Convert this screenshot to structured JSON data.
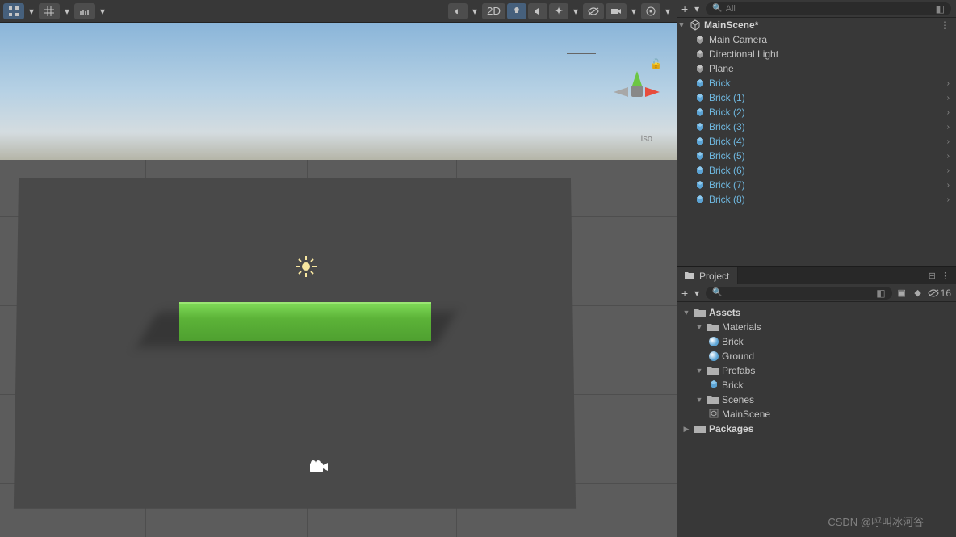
{
  "toolbar": {
    "mode_2d": "2D"
  },
  "scene": {
    "persp_label": "Iso"
  },
  "hierarchy": {
    "search_placeholder": "All",
    "scene_name": "MainScene*",
    "items": [
      {
        "label": "Main Camera",
        "prefab": false,
        "chevron": false
      },
      {
        "label": "Directional Light",
        "prefab": false,
        "chevron": false
      },
      {
        "label": "Plane",
        "prefab": false,
        "chevron": false
      },
      {
        "label": "Brick",
        "prefab": true,
        "chevron": true
      },
      {
        "label": "Brick (1)",
        "prefab": true,
        "chevron": true
      },
      {
        "label": "Brick (2)",
        "prefab": true,
        "chevron": true
      },
      {
        "label": "Brick (3)",
        "prefab": true,
        "chevron": true
      },
      {
        "label": "Brick (4)",
        "prefab": true,
        "chevron": true
      },
      {
        "label": "Brick (5)",
        "prefab": true,
        "chevron": true
      },
      {
        "label": "Brick (6)",
        "prefab": true,
        "chevron": true
      },
      {
        "label": "Brick (7)",
        "prefab": true,
        "chevron": true
      },
      {
        "label": "Brick (8)",
        "prefab": true,
        "chevron": true
      }
    ]
  },
  "project": {
    "tab_label": "Project",
    "hidden_count": "16",
    "tree": {
      "assets": "Assets",
      "materials": "Materials",
      "mat_brick": "Brick",
      "mat_ground": "Ground",
      "prefabs": "Prefabs",
      "prefab_brick": "Brick",
      "scenes": "Scenes",
      "scene_main": "MainScene",
      "packages": "Packages"
    }
  },
  "watermark": "CSDN @呼叫冰河谷"
}
